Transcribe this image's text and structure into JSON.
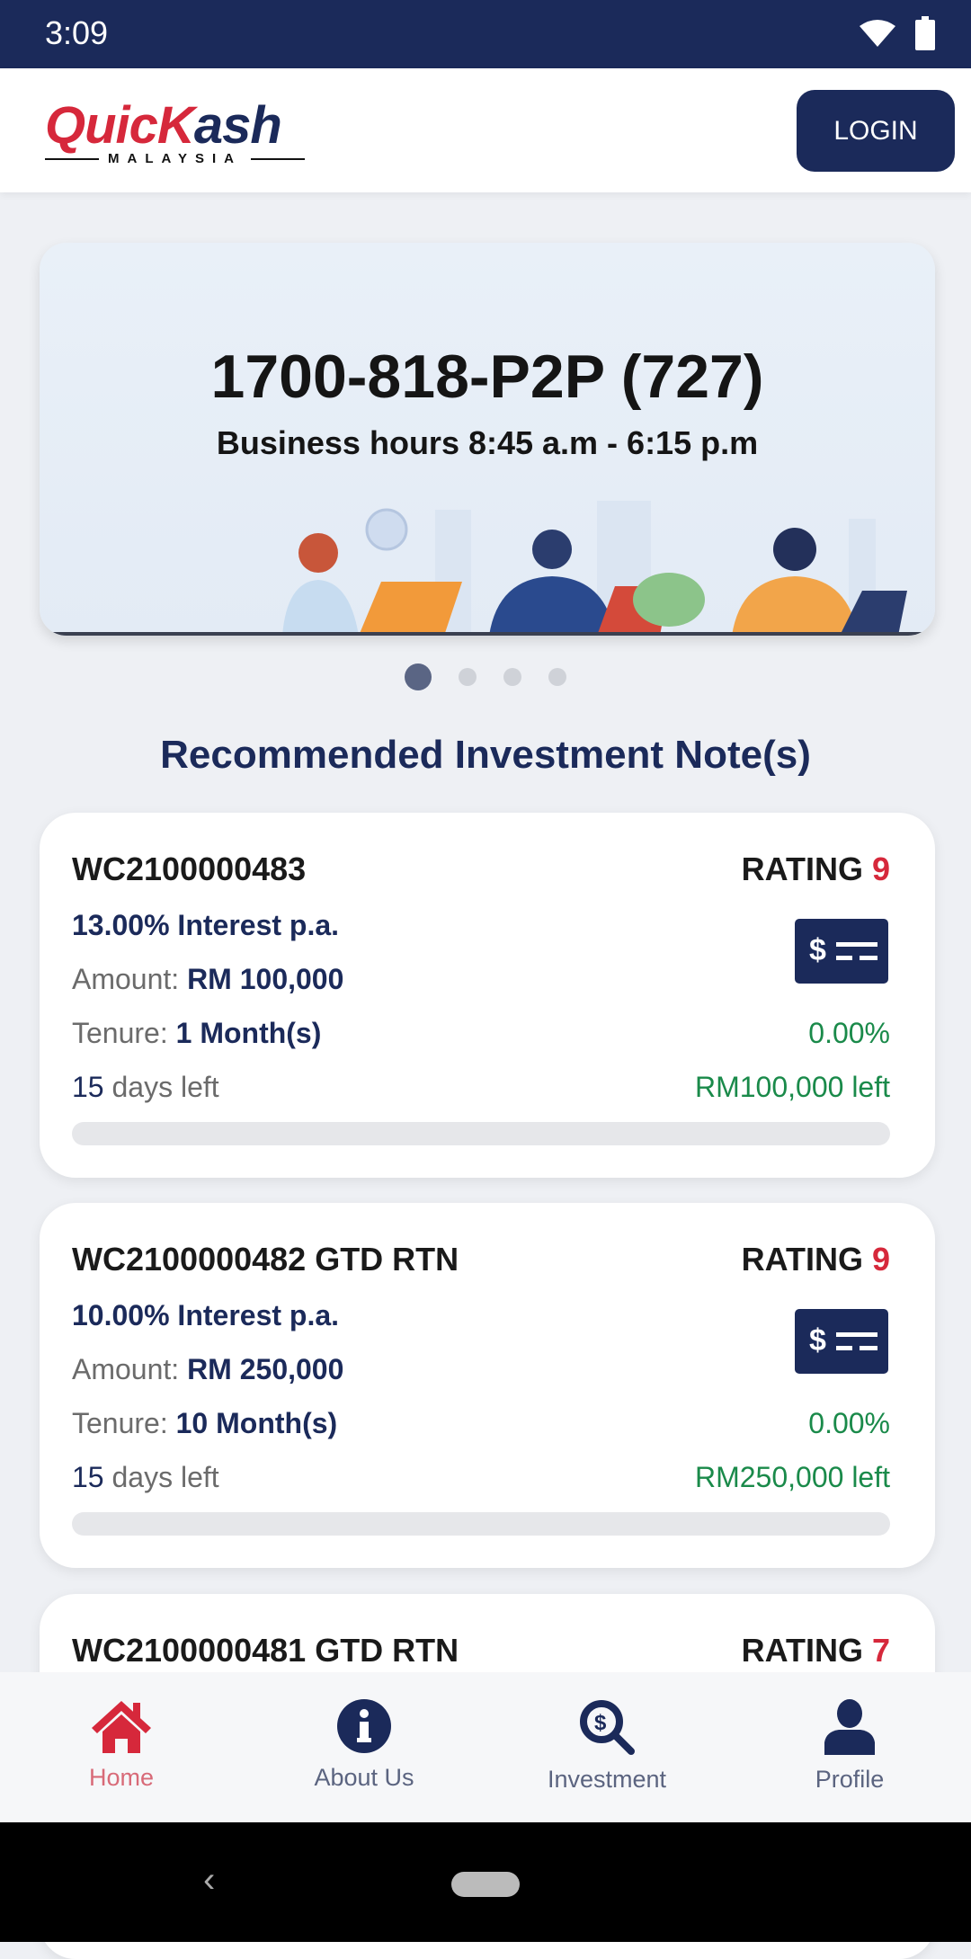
{
  "status_bar": {
    "time": "3:09"
  },
  "header": {
    "logo_text": "QuicKash",
    "logo_sub": "MALAYSIA",
    "login_label": "LOGIN"
  },
  "banner": {
    "phone": "1700-818-P2P (727)",
    "hours": "Business hours 8:45 a.m - 6:15 p.m",
    "slide_count": 4,
    "active_slide": 1
  },
  "section_title": "Recommended Investment Note(s)",
  "colors": {
    "primary": "#1b2a5a",
    "accent": "#d6283b",
    "success": "#1a8a4a"
  },
  "cards": [
    {
      "id": "WC2100000483",
      "rating_label": "RATING",
      "rating": "9",
      "interest": "13.00% Interest p.a.",
      "amount_label": "Amount:",
      "amount": "RM 100,000",
      "tenure_label": "Tenure:",
      "tenure": "1 Month(s)",
      "funded": "0.00%",
      "days": "15",
      "days_label": "days left",
      "remaining": "RM100,000 left",
      "progress": 0
    },
    {
      "id": "WC2100000482 GTD RTN",
      "rating_label": "RATING",
      "rating": "9",
      "interest": "10.00% Interest p.a.",
      "amount_label": "Amount:",
      "amount": "RM 250,000",
      "tenure_label": "Tenure:",
      "tenure": "10 Month(s)",
      "funded": "0.00%",
      "days": "15",
      "days_label": "days left",
      "remaining": "RM250,000 left",
      "progress": 0
    },
    {
      "id": "WC2100000481 GTD RTN",
      "rating_label": "RATING",
      "rating": "7"
    }
  ],
  "bottom_nav": [
    {
      "label": "Home",
      "icon": "home-icon",
      "active": true
    },
    {
      "label": "About Us",
      "icon": "info-icon"
    },
    {
      "label": "Investment",
      "icon": "dollar-search-icon"
    },
    {
      "label": "Profile",
      "icon": "user-icon"
    }
  ]
}
